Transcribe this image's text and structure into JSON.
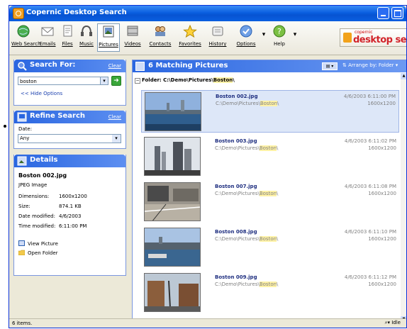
{
  "window": {
    "title": "Copernic Desktop Search"
  },
  "toolbar": {
    "items": [
      {
        "label": "Web Search",
        "icon": "globe-icon"
      },
      {
        "label": "Emails",
        "icon": "envelope-icon"
      },
      {
        "label": "Files",
        "icon": "document-icon"
      },
      {
        "label": "Music",
        "icon": "headphones-icon"
      },
      {
        "label": "Pictures",
        "icon": "picture-icon"
      },
      {
        "label": "Videos",
        "icon": "film-icon"
      },
      {
        "label": "Contacts",
        "icon": "contacts-icon"
      },
      {
        "label": "Favorites",
        "icon": "star-icon"
      },
      {
        "label": "History",
        "icon": "history-icon"
      },
      {
        "label": "Options",
        "icon": "checkmark-icon"
      },
      {
        "label": "Help",
        "icon": "help-icon"
      }
    ],
    "brand_small": "copernic",
    "brand_big": "desktop search"
  },
  "search_panel": {
    "title": "Search For:",
    "clear": "Clear",
    "query": "boston",
    "hide_options": "<< Hide Options"
  },
  "refine_panel": {
    "title": "Refine Search",
    "clear": "Clear",
    "date_label": "Date:",
    "date_value": "Any"
  },
  "details_panel": {
    "title": "Details",
    "filename": "Boston 002.jpg",
    "filetype": "JPEG Image",
    "fields": [
      {
        "label": "Dimensions:",
        "value": "1600x1200"
      },
      {
        "label": "Size:",
        "value": "874.1 KB"
      },
      {
        "label": "Date modified:",
        "value": "4/6/2003"
      },
      {
        "label": "Time modified:",
        "value": "6:11:00 PM"
      }
    ],
    "view_picture": "View Picture",
    "open_folder": "Open Folder"
  },
  "results": {
    "title": "6 Matching Pictures",
    "arrange": "Arrange by: Folder",
    "folder_prefix": "Folder: C:\\Demo\\Pictures\\",
    "folder_highlight": "Boston",
    "folder_suffix": "\\",
    "items": [
      {
        "name": "Boston 002.jpg",
        "path_prefix": "C:\\Demo\\Pictures\\",
        "path_highlight": "Boston",
        "path_suffix": "\\",
        "date": "4/6/2003 6:11:00 PM",
        "dims": "1600x1200",
        "selected": true
      },
      {
        "name": "Boston 003.jpg",
        "path_prefix": "C:\\Demo\\Pictures\\",
        "path_highlight": "Boston",
        "path_suffix": "\\",
        "date": "4/6/2003 6:11:02 PM",
        "dims": "1600x1200",
        "selected": false
      },
      {
        "name": "Boston 007.jpg",
        "path_prefix": "C:\\Demo\\Pictures\\",
        "path_highlight": "Boston",
        "path_suffix": "\\",
        "date": "4/6/2003 6:11:08 PM",
        "dims": "1600x1200",
        "selected": false
      },
      {
        "name": "Boston 008.jpg",
        "path_prefix": "C:\\Demo\\Pictures\\",
        "path_highlight": "Boston",
        "path_suffix": "\\",
        "date": "4/6/2003 6:11:10 PM",
        "dims": "1600x1200",
        "selected": false
      },
      {
        "name": "Boston 009.jpg",
        "path_prefix": "C:\\Demo\\Pictures\\",
        "path_highlight": "Boston",
        "path_suffix": "\\",
        "date": "4/6/2003 6:11:12 PM",
        "dims": "1600x1200",
        "selected": false
      }
    ]
  },
  "status": {
    "left": "6 items.",
    "right": "Idle"
  },
  "colors": {
    "accent": "#2a66e0",
    "selection": "#dde7f8",
    "highlight": "#fff2a6",
    "brand": "#d2232a"
  }
}
